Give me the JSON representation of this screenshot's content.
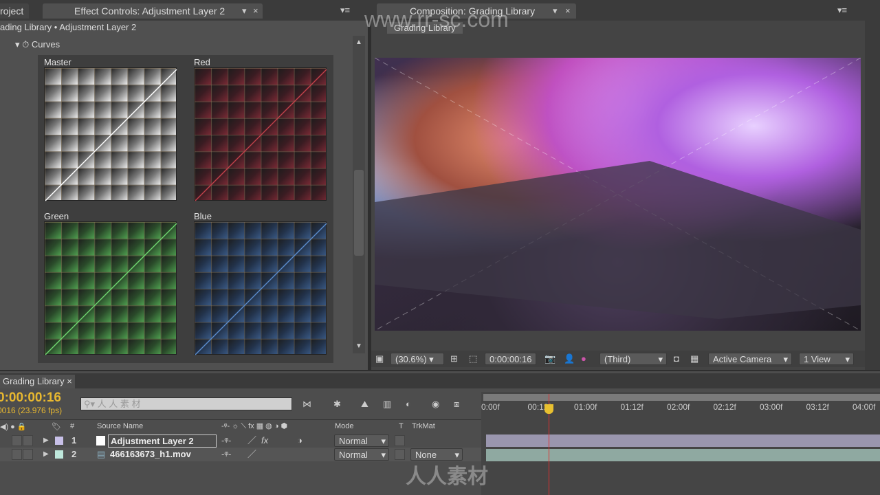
{
  "left_tabs": {
    "project": "roject",
    "effect_controls": "Effect Controls: Adjustment Layer 2"
  },
  "effect_breadcrumb": "ading Library • Adjustment Layer 2",
  "effect": {
    "name": "Curves",
    "graphs": [
      {
        "label": "Master",
        "color": "#ffffff"
      },
      {
        "label": "Red",
        "color": "#c0404a"
      },
      {
        "label": "Green",
        "color": "#4fae4f"
      },
      {
        "label": "Blue",
        "color": "#4a7ab8"
      }
    ]
  },
  "comp": {
    "tab": "Composition: Grading Library",
    "subtab": "Grading Library",
    "watermark": "www.rr-sc.com"
  },
  "viewer_toolbar": {
    "zoom": "(30.6%)",
    "timecode": "0:00:00:16",
    "resolution": "(Third)",
    "camera": "Active Camera",
    "views": "1 View"
  },
  "timeline": {
    "tab": "Grading Library",
    "current_time": "0:00:00:16",
    "frame_info": "0016 (23.976 fps)",
    "search_placeholder": "人 人 素 材",
    "headers": {
      "number": "#",
      "source_name": "Source Name",
      "mode": "Mode",
      "t": "T",
      "trkmat": "TrkMat"
    },
    "layers": [
      {
        "index": "1",
        "name": "Adjustment Layer 2",
        "mode": "Normal",
        "trkmat": "",
        "label_color": "#c8c0e8",
        "bar_color": "#9a96ae"
      },
      {
        "index": "2",
        "name": "466163673_h1.mov",
        "mode": "Normal",
        "trkmat": "None",
        "label_color": "#bfe8dc",
        "bar_color": "#8fa9a1"
      }
    ],
    "ruler": [
      "0:00f",
      "00:12f",
      "01:00f",
      "01:12f",
      "02:00f",
      "02:12f",
      "03:00f",
      "03:12f",
      "04:00f"
    ],
    "playhead_color": "#e03030"
  },
  "watermark_bottom": "人人素材"
}
